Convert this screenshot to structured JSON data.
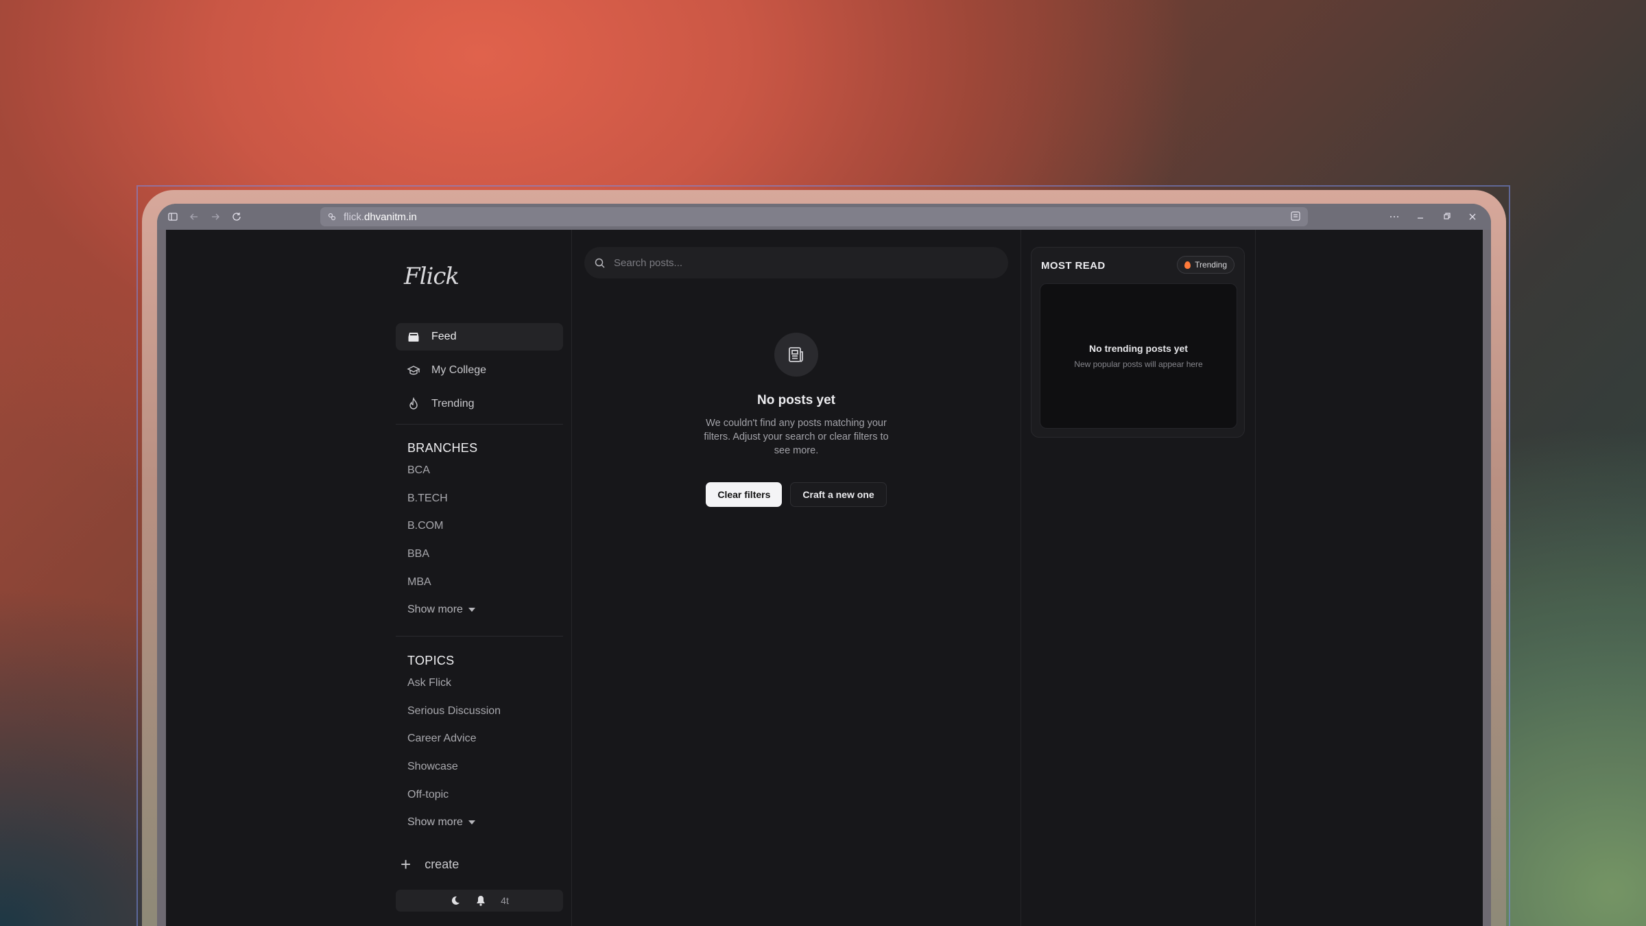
{
  "browser": {
    "url_prefix": "flick.",
    "url_domain": "dhvanitm.in"
  },
  "app": {
    "logo": "Flick"
  },
  "nav": {
    "items": [
      {
        "label": "Feed",
        "icon": "inbox-icon",
        "active": true
      },
      {
        "label": "My College",
        "icon": "graduation-cap-icon",
        "active": false
      },
      {
        "label": "Trending",
        "icon": "flame-icon",
        "active": false
      }
    ]
  },
  "branches": {
    "title": "BRANCHES",
    "items": [
      "BCA",
      "B.TECH",
      "B.COM",
      "BBA",
      "MBA"
    ],
    "show_more": "Show more"
  },
  "topics": {
    "title": "TOPICS",
    "items": [
      "Ask Flick",
      "Serious Discussion",
      "Career Advice",
      "Showcase",
      "Off-topic"
    ],
    "show_more": "Show more"
  },
  "create": {
    "label": "create"
  },
  "bottom_bar": {
    "badge": "4t"
  },
  "search": {
    "placeholder": "Search posts..."
  },
  "empty_state": {
    "title": "No posts yet",
    "description": "We couldn't find any posts matching your filters. Adjust your search or clear filters to see more.",
    "primary_action": "Clear filters",
    "secondary_action": "Craft a new one"
  },
  "most_read": {
    "title": "MOST READ",
    "badge": "Trending",
    "empty_title": "No trending posts yet",
    "empty_subtitle": "New popular posts will appear here"
  },
  "colors": {
    "app_bg": "#17171a",
    "accent_flame": "#ff7a3a"
  }
}
